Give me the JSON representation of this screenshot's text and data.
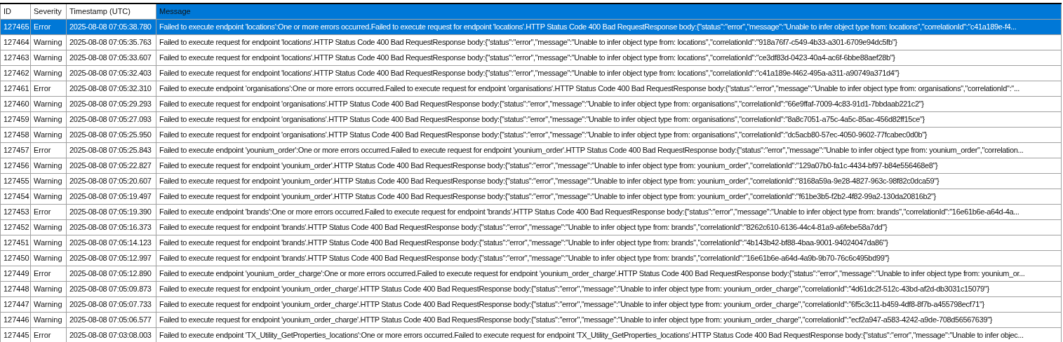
{
  "table": {
    "columns": [
      {
        "label": "ID",
        "selected": false
      },
      {
        "label": "Severity",
        "selected": false
      },
      {
        "label": "Timestamp (UTC)",
        "selected": false
      },
      {
        "label": "Message",
        "selected": true
      }
    ],
    "rows": [
      {
        "selected": true,
        "id": "127465",
        "severity": "Error",
        "timestamp": "2025-08-08 07:05:38.780",
        "message": "Failed to execute endpoint 'locations':One or more errors occurred.Failed to execute request for endpoint 'locations'.HTTP Status Code 400 Bad RequestResponse body:{\"status\":\"error\",\"message\":\"Unable to infer object type from: locations\",\"correlationId\":\"c41a189e-f4..."
      },
      {
        "selected": false,
        "id": "127464",
        "severity": "Warning",
        "timestamp": "2025-08-08 07:05:35.763",
        "message": "Failed to execute request for endpoint 'locations'.HTTP Status Code 400 Bad RequestResponse body:{\"status\":\"error\",\"message\":\"Unable to infer object type from: locations\",\"correlationId\":\"918a76f7-c549-4b33-a301-6709e94dc5fb\"}"
      },
      {
        "selected": false,
        "id": "127463",
        "severity": "Warning",
        "timestamp": "2025-08-08 07:05:33.607",
        "message": "Failed to execute request for endpoint 'locations'.HTTP Status Code 400 Bad RequestResponse body:{\"status\":\"error\",\"message\":\"Unable to infer object type from: locations\",\"correlationId\":\"ce3df83d-0423-40a4-ac6f-6bbe88aef28b\"}"
      },
      {
        "selected": false,
        "id": "127462",
        "severity": "Warning",
        "timestamp": "2025-08-08 07:05:32.403",
        "message": "Failed to execute request for endpoint 'locations'.HTTP Status Code 400 Bad RequestResponse body:{\"status\":\"error\",\"message\":\"Unable to infer object type from: locations\",\"correlationId\":\"c41a189e-f462-495a-a311-a90749a371d4\"}"
      },
      {
        "selected": false,
        "id": "127461",
        "severity": "Error",
        "timestamp": "2025-08-08 07:05:32.310",
        "message": "Failed to execute endpoint 'organisations':One or more errors occurred.Failed to execute request for endpoint 'organisations'.HTTP Status Code 400 Bad RequestResponse body:{\"status\":\"error\",\"message\":\"Unable to infer object type from: organisations\",\"correlationId\":\"..."
      },
      {
        "selected": false,
        "id": "127460",
        "severity": "Warning",
        "timestamp": "2025-08-08 07:05:29.293",
        "message": "Failed to execute request for endpoint 'organisations'.HTTP Status Code 400 Bad RequestResponse body:{\"status\":\"error\",\"message\":\"Unable to infer object type from: organisations\",\"correlationId\":\"66e9ffaf-7009-4c83-91d1-7bbdaab221c2\"}"
      },
      {
        "selected": false,
        "id": "127459",
        "severity": "Warning",
        "timestamp": "2025-08-08 07:05:27.093",
        "message": "Failed to execute request for endpoint 'organisations'.HTTP Status Code 400 Bad RequestResponse body:{\"status\":\"error\",\"message\":\"Unable to infer object type from: organisations\",\"correlationId\":\"8a8c7051-a75c-4a5c-85ac-456d82ff15ce\"}"
      },
      {
        "selected": false,
        "id": "127458",
        "severity": "Warning",
        "timestamp": "2025-08-08 07:05:25.950",
        "message": "Failed to execute request for endpoint 'organisations'.HTTP Status Code 400 Bad RequestResponse body:{\"status\":\"error\",\"message\":\"Unable to infer object type from: organisations\",\"correlationId\":\"dc5acb80-57ec-4050-9602-77fcabec0d0b\"}"
      },
      {
        "selected": false,
        "id": "127457",
        "severity": "Error",
        "timestamp": "2025-08-08 07:05:25.843",
        "message": "Failed to execute endpoint 'younium_order':One or more errors occurred.Failed to execute request for endpoint 'younium_order'.HTTP Status Code 400 Bad RequestResponse body:{\"status\":\"error\",\"message\":\"Unable to infer object type from: younium_order\",\"correlation..."
      },
      {
        "selected": false,
        "id": "127456",
        "severity": "Warning",
        "timestamp": "2025-08-08 07:05:22.827",
        "message": "Failed to execute request for endpoint 'younium_order'.HTTP Status Code 400 Bad RequestResponse body:{\"status\":\"error\",\"message\":\"Unable to infer object type from: younium_order\",\"correlationId\":\"129a07b0-fa1c-4434-bf97-b84e556468e8\"}"
      },
      {
        "selected": false,
        "id": "127455",
        "severity": "Warning",
        "timestamp": "2025-08-08 07:05:20.607",
        "message": "Failed to execute request for endpoint 'younium_order'.HTTP Status Code 400 Bad RequestResponse body:{\"status\":\"error\",\"message\":\"Unable to infer object type from: younium_order\",\"correlationId\":\"8168a59a-9e28-4827-963c-98f82c0dca59\"}"
      },
      {
        "selected": false,
        "id": "127454",
        "severity": "Warning",
        "timestamp": "2025-08-08 07:05:19.497",
        "message": "Failed to execute request for endpoint 'younium_order'.HTTP Status Code 400 Bad RequestResponse body:{\"status\":\"error\",\"message\":\"Unable to infer object type from: younium_order\",\"correlationId\":\"f61be3b5-f2b2-4f82-99a2-130da20816b2\"}"
      },
      {
        "selected": false,
        "id": "127453",
        "severity": "Error",
        "timestamp": "2025-08-08 07:05:19.390",
        "message": "Failed to execute endpoint 'brands':One or more errors occurred.Failed to execute request for endpoint 'brands'.HTTP Status Code 400 Bad RequestResponse body:{\"status\":\"error\",\"message\":\"Unable to infer object type from: brands\",\"correlationId\":\"16e61b6e-a64d-4a..."
      },
      {
        "selected": false,
        "id": "127452",
        "severity": "Warning",
        "timestamp": "2025-08-08 07:05:16.373",
        "message": "Failed to execute request for endpoint 'brands'.HTTP Status Code 400 Bad RequestResponse body:{\"status\":\"error\",\"message\":\"Unable to infer object type from: brands\",\"correlationId\":\"8262c610-6136-44c4-81a9-a6febe58a7dd\"}"
      },
      {
        "selected": false,
        "id": "127451",
        "severity": "Warning",
        "timestamp": "2025-08-08 07:05:14.123",
        "message": "Failed to execute request for endpoint 'brands'.HTTP Status Code 400 Bad RequestResponse body:{\"status\":\"error\",\"message\":\"Unable to infer object type from: brands\",\"correlationId\":\"4b143b42-bf88-4baa-9001-94024047da86\"}"
      },
      {
        "selected": false,
        "id": "127450",
        "severity": "Warning",
        "timestamp": "2025-08-08 07:05:12.997",
        "message": "Failed to execute request for endpoint 'brands'.HTTP Status Code 400 Bad RequestResponse body:{\"status\":\"error\",\"message\":\"Unable to infer object type from: brands\",\"correlationId\":\"16e61b6e-a64d-4a9b-9b70-76c6c495bd99\"}"
      },
      {
        "selected": false,
        "id": "127449",
        "severity": "Error",
        "timestamp": "2025-08-08 07:05:12.890",
        "message": "Failed to execute endpoint 'younium_order_charge':One or more errors occurred.Failed to execute request for endpoint 'younium_order_charge'.HTTP Status Code 400 Bad RequestResponse body:{\"status\":\"error\",\"message\":\"Unable to infer object type from: younium_or..."
      },
      {
        "selected": false,
        "id": "127448",
        "severity": "Warning",
        "timestamp": "2025-08-08 07:05:09.873",
        "message": "Failed to execute request for endpoint 'younium_order_charge'.HTTP Status Code 400 Bad RequestResponse body:{\"status\":\"error\",\"message\":\"Unable to infer object type from: younium_order_charge\",\"correlationId\":\"4d61dc2f-512c-43bd-af2d-db3031c15079\"}"
      },
      {
        "selected": false,
        "id": "127447",
        "severity": "Warning",
        "timestamp": "2025-08-08 07:05:07.733",
        "message": "Failed to execute request for endpoint 'younium_order_charge'.HTTP Status Code 400 Bad RequestResponse body:{\"status\":\"error\",\"message\":\"Unable to infer object type from: younium_order_charge\",\"correlationId\":\"6f5c3c11-b459-4df8-8f7b-a455798ecf71\"}"
      },
      {
        "selected": false,
        "id": "127446",
        "severity": "Warning",
        "timestamp": "2025-08-08 07:05:06.577",
        "message": "Failed to execute request for endpoint 'younium_order_charge'.HTTP Status Code 400 Bad RequestResponse body:{\"status\":\"error\",\"message\":\"Unable to infer object type from: younium_order_charge\",\"correlationId\":\"ecf2a947-a583-4242-a9de-708d56567639\"}"
      },
      {
        "selected": false,
        "id": "127445",
        "severity": "Error",
        "timestamp": "2025-08-08 07:03:08.003",
        "message": "Failed to execute endpoint 'TX_Utility_GetProperties_locations':One or more errors occurred.Failed to execute request for endpoint 'TX_Utility_GetProperties_locations'.HTTP Status Code 400 Bad RequestResponse body:{\"status\":\"error\",\"message\":\"Unable to infer objec..."
      }
    ]
  }
}
